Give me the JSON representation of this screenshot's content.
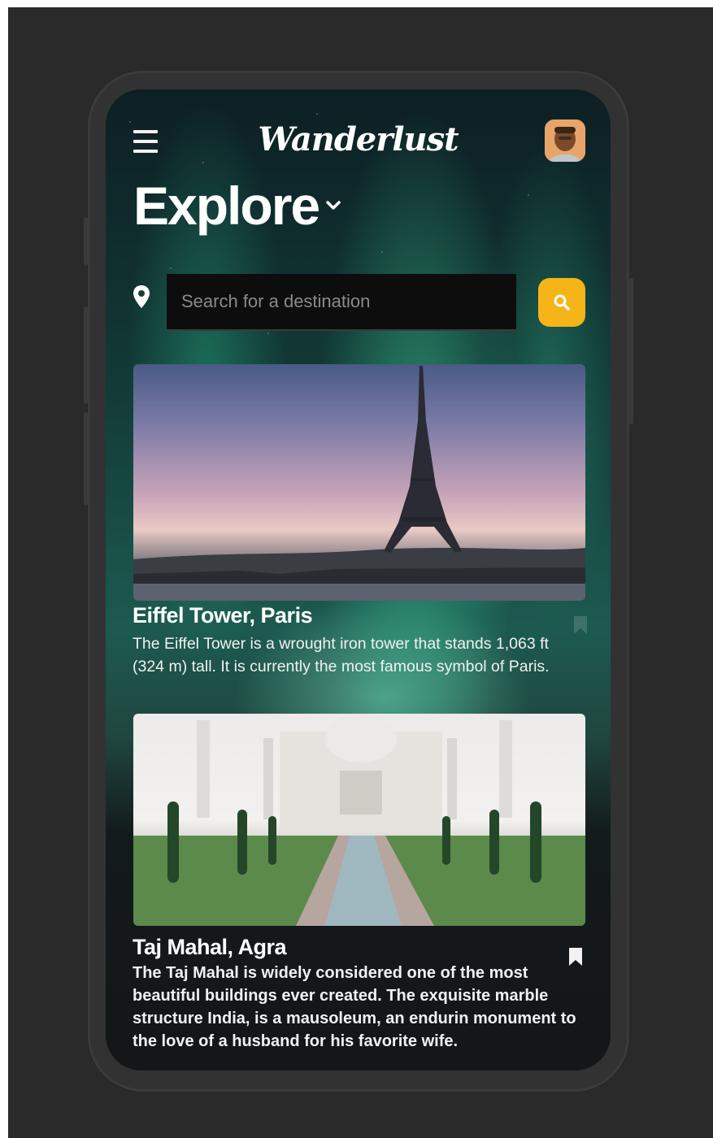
{
  "header": {
    "brand": "Wanderlust",
    "title": "Explore"
  },
  "search": {
    "placeholder": "Search for a destination",
    "value": ""
  },
  "cards": [
    {
      "title": "Eiffel Tower, Paris",
      "description": "The Eiffel Tower is a wrought iron tower that stands 1,063 ft (324 m) tall. It is currently the most famous symbol of Paris."
    },
    {
      "title": "Taj Mahal, Agra",
      "description": "The Taj Mahal is widely considered one of the most beautiful buildings ever created. The exquisite marble structure India, is a mausoleum, an endurin monument to the love of a husband for his favorite wife."
    }
  ],
  "icons": {
    "menu": "menu-icon",
    "caret": "chevron-down-icon",
    "location": "location-pin-icon",
    "search": "search-icon",
    "bookmark": "bookmark-icon"
  },
  "colors": {
    "accent": "#f5b417",
    "text": "#ffffff",
    "search_bg": "#0d0d0d"
  }
}
